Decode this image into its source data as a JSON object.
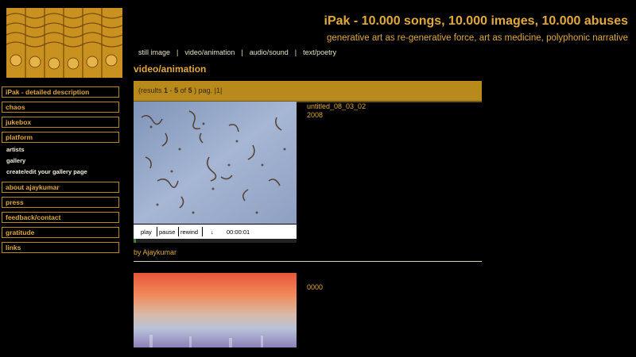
{
  "header": {
    "title": "iPak - 10.000 songs, 10.000 images, 10.000 abuses",
    "subtitle": "generative art as re-generative force, art as medicine, polyphonic narrative"
  },
  "topnav": [
    "still image",
    "video/animation",
    "audio/sound",
    "text/poetry"
  ],
  "section_title": "video/animation",
  "results": {
    "prefix": "(results",
    "from": "1",
    "dash": "-",
    "to": "5",
    "of_word": "of",
    "total": "5",
    "suffix": ") pag. |1|"
  },
  "sidebar": {
    "items": [
      "iPak - detailed description",
      "chaos",
      "jukebox",
      "platform"
    ],
    "platform_sub": [
      "artists",
      "gallery",
      "create/edit your gallery page"
    ],
    "items_after": [
      "about ajaykumar",
      "press",
      "feedback/contact",
      "gratitude",
      "links"
    ]
  },
  "entries": [
    {
      "title": "untitled_08_03_02",
      "year": "2008",
      "controls": {
        "play": "play",
        "pause": "pause",
        "rewind": "rewind",
        "download": "↓",
        "time": "00:00:01"
      },
      "progress": 0.015,
      "by_prefix": "by",
      "author": "Ajaykumar"
    },
    {
      "title": "0000"
    }
  ],
  "colors": {
    "background": "#000000",
    "accent": "#e0a93a",
    "bar": "#b88a1c"
  }
}
